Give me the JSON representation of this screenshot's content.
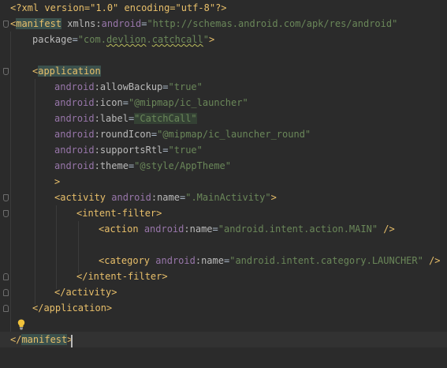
{
  "lines": [
    [
      [
        "<?xml version=\"1.0\" encoding=\"utf-8\"?>",
        "decl"
      ]
    ],
    [
      [
        "<",
        "tag"
      ],
      [
        "manifest",
        "tag tag-hl"
      ],
      [
        " ",
        "pl"
      ],
      [
        "xmlns",
        "attr"
      ],
      [
        ":",
        "attr"
      ],
      [
        "android",
        "ns"
      ],
      [
        "=",
        "pl"
      ],
      [
        "\"http://schemas.android.com/apk/res/android\"",
        "val"
      ]
    ],
    [
      [
        "package",
        "attr"
      ],
      [
        "=",
        "pl"
      ],
      [
        "\"com.",
        "val"
      ],
      [
        "devlion",
        "val squiggle"
      ],
      [
        ".",
        "val"
      ],
      [
        "catchcall",
        "val squiggle"
      ],
      [
        "\"",
        "val"
      ],
      [
        ">",
        "tag"
      ]
    ],
    [],
    [
      [
        "<",
        "tag"
      ],
      [
        "application",
        "tag tag-hl"
      ]
    ],
    [
      [
        "android",
        "ns"
      ],
      [
        ":",
        "attr"
      ],
      [
        "allowBackup",
        "attr"
      ],
      [
        "=",
        "pl"
      ],
      [
        "\"true\"",
        "val"
      ]
    ],
    [
      [
        "android",
        "ns"
      ],
      [
        ":",
        "attr"
      ],
      [
        "icon",
        "attr"
      ],
      [
        "=",
        "pl"
      ],
      [
        "\"@mipmap/ic_launcher\"",
        "val"
      ]
    ],
    [
      [
        "android",
        "ns"
      ],
      [
        ":",
        "attr"
      ],
      [
        "label",
        "attr"
      ],
      [
        "=",
        "pl"
      ],
      [
        "\"CatchCall\"",
        "val label-hl"
      ]
    ],
    [
      [
        "android",
        "ns"
      ],
      [
        ":",
        "attr"
      ],
      [
        "roundIcon",
        "attr"
      ],
      [
        "=",
        "pl"
      ],
      [
        "\"@mipmap/ic_launcher_round\"",
        "val"
      ]
    ],
    [
      [
        "android",
        "ns"
      ],
      [
        ":",
        "attr"
      ],
      [
        "supportsRtl",
        "attr"
      ],
      [
        "=",
        "pl"
      ],
      [
        "\"true\"",
        "val"
      ]
    ],
    [
      [
        "android",
        "ns"
      ],
      [
        ":",
        "attr"
      ],
      [
        "theme",
        "attr"
      ],
      [
        "=",
        "pl"
      ],
      [
        "\"@style/AppTheme\"",
        "val"
      ]
    ],
    [
      [
        ">",
        "tag"
      ]
    ],
    [
      [
        "<activity",
        "tag"
      ],
      [
        " ",
        "pl"
      ],
      [
        "android",
        "ns"
      ],
      [
        ":",
        "attr"
      ],
      [
        "name",
        "attr"
      ],
      [
        "=",
        "pl"
      ],
      [
        "\".MainActivity\"",
        "val"
      ],
      [
        ">",
        "tag"
      ]
    ],
    [
      [
        "<intent-filter>",
        "tag"
      ]
    ],
    [
      [
        "<action",
        "tag"
      ],
      [
        " ",
        "pl"
      ],
      [
        "android",
        "ns"
      ],
      [
        ":",
        "attr"
      ],
      [
        "name",
        "attr"
      ],
      [
        "=",
        "pl"
      ],
      [
        "\"android.intent.action.MAIN\"",
        "val"
      ],
      [
        " />",
        "tag"
      ]
    ],
    [],
    [
      [
        "<category",
        "tag"
      ],
      [
        " ",
        "pl"
      ],
      [
        "android",
        "ns"
      ],
      [
        ":",
        "attr"
      ],
      [
        "name",
        "attr"
      ],
      [
        "=",
        "pl"
      ],
      [
        "\"android.intent.category.LAUNCHER\"",
        "val"
      ],
      [
        " />",
        "tag"
      ]
    ],
    [
      [
        "</intent-filter>",
        "tag"
      ]
    ],
    [
      [
        "</activity>",
        "tag"
      ]
    ],
    [
      [
        "</application>",
        "tag"
      ]
    ],
    [],
    [
      [
        "</",
        "tag"
      ],
      [
        "manifest",
        "tag tag-hl"
      ],
      [
        ">",
        "tag"
      ]
    ]
  ]
}
